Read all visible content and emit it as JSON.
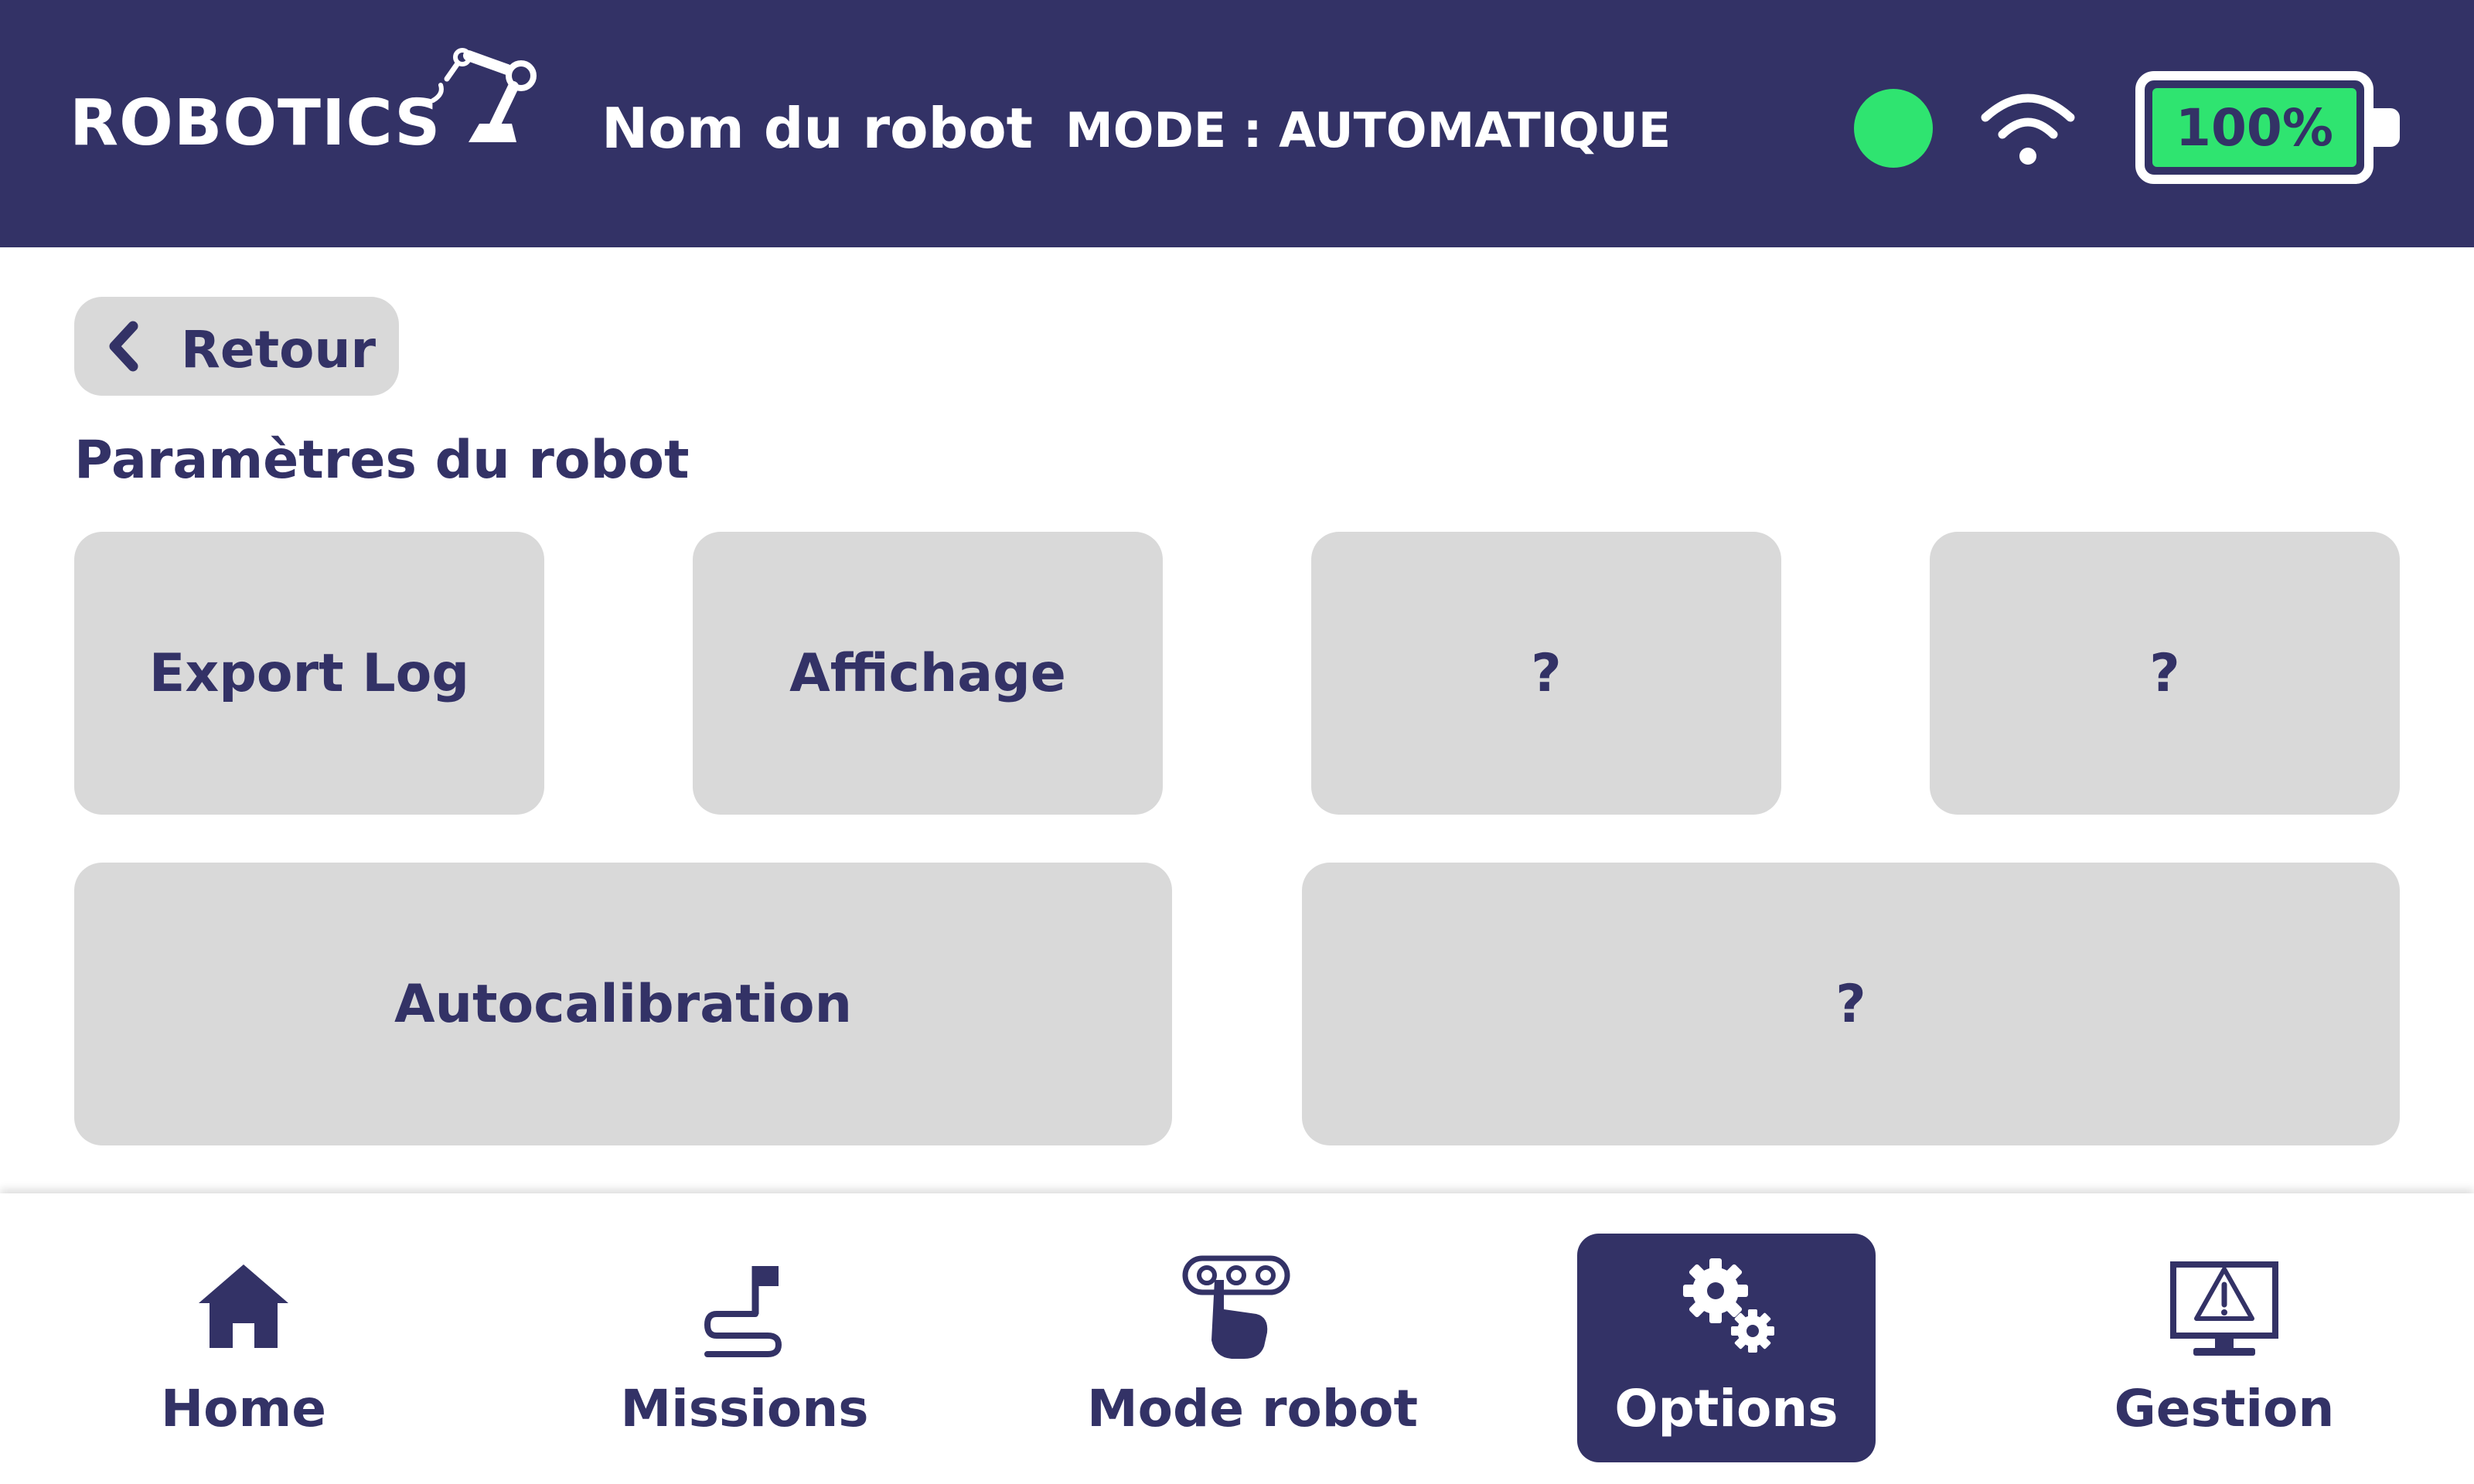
{
  "header": {
    "logo": "ROBOTICS",
    "robot_name": "Nom du robot",
    "mode": "MODE : AUTOMATIQUE",
    "status_color": "#2fe470",
    "battery": {
      "label": "100%",
      "level": 100
    }
  },
  "main": {
    "back_label": "Retour",
    "section_title": "Paramètres du robot",
    "tiles": [
      "Export Log",
      "Affichage",
      "?",
      "?",
      "Autocalibration",
      "?"
    ]
  },
  "nav": {
    "active": "Options",
    "items": [
      {
        "label": "Home",
        "icon": "home-icon"
      },
      {
        "label": "Missions",
        "icon": "mission-path-flag-icon"
      },
      {
        "label": "Mode robot",
        "icon": "hand-control-icon"
      },
      {
        "label": "Options",
        "icon": "gears-icon"
      },
      {
        "label": "Gestion",
        "icon": "monitor-warning-icon"
      }
    ]
  },
  "colors": {
    "primary": "#333266",
    "accent": "#2fe470",
    "tile": "#d9d9d9",
    "background": "#ffffff"
  }
}
